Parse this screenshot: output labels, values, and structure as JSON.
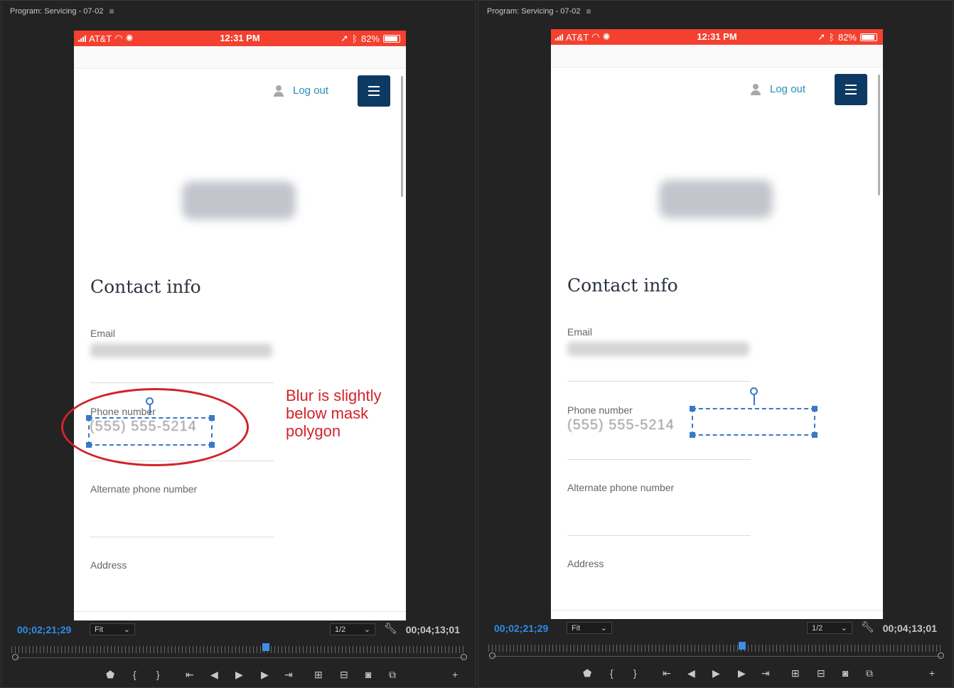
{
  "panel_title": "Program: Servicing - 07-02",
  "status": {
    "carrier": "AT&T",
    "time": "12:31 PM",
    "battery": "82%"
  },
  "header": {
    "logout_label": "Log out"
  },
  "contact": {
    "heading": "Contact info",
    "email_label": "Email",
    "phone_label": "Phone number",
    "phone_value": "(555) 555-5214",
    "alt_phone_label": "Alternate phone number",
    "address_label": "Address"
  },
  "annotation": {
    "text": "Blur is slightly below mask polygon",
    "color": "#d2232a"
  },
  "playback": {
    "current_timecode": "00;02;21;29",
    "duration_timecode": "00;04;13;01",
    "zoom_option": "Fit",
    "resolution_option": "1/2"
  },
  "icons": [
    "list-menu-icon",
    "signal-icon",
    "wifi-icon",
    "loading-icon",
    "location-icon",
    "bluetooth-icon",
    "battery-icon",
    "person-icon",
    "hamburger-icon",
    "wrench-icon",
    "marker-icon",
    "in-point-icon",
    "out-point-icon",
    "go-to-in-icon",
    "step-back-icon",
    "play-icon",
    "step-forward-icon",
    "go-to-out-icon",
    "lift-icon",
    "extract-icon",
    "camera-icon",
    "compare-icon",
    "add-icon"
  ],
  "colors": {
    "accent_blue": "#2d8ceb",
    "status_red": "#f4402f",
    "mask_blue": "#3b78c9",
    "menu_navy": "#0c3a63"
  }
}
